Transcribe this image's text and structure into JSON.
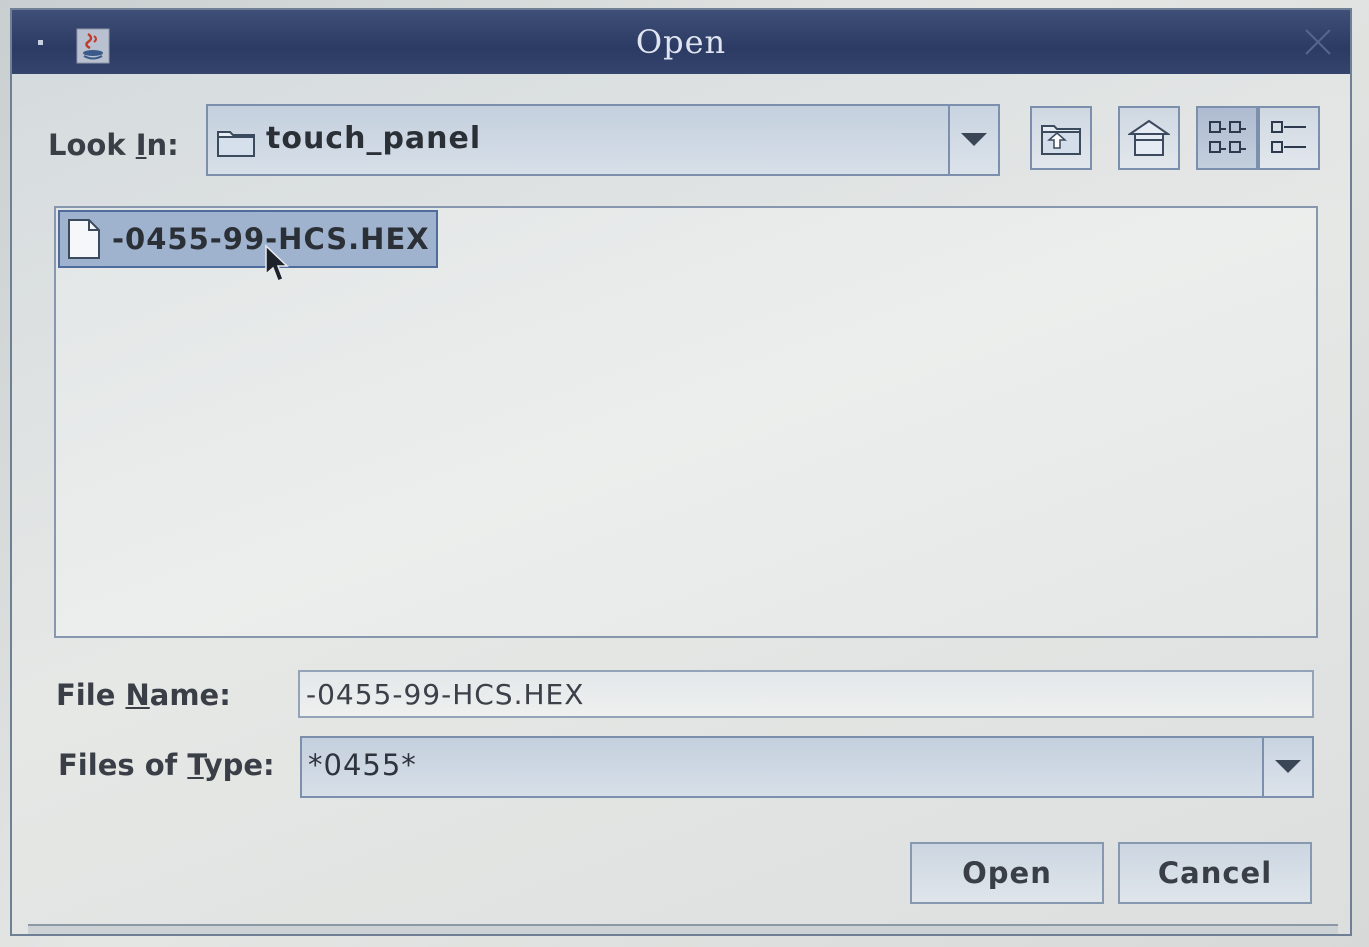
{
  "window": {
    "title": "Open"
  },
  "look_in": {
    "label_pre": "Look ",
    "label_mnemonic": "I",
    "label_post": "n:",
    "value": "touch_panel"
  },
  "toolbar": {
    "up_one_level_icon": "folder-up-icon",
    "home_icon": "home-icon",
    "list_view_icon": "list-view-icon",
    "details_view_icon": "details-view-icon"
  },
  "file_list": {
    "items": [
      {
        "name": "-0455-99-HCS.HEX",
        "selected": true
      }
    ]
  },
  "file_name": {
    "label_pre": "File ",
    "label_mnemonic": "N",
    "label_post": "ame:",
    "value": "-0455-99-HCS.HEX"
  },
  "files_of_type": {
    "label_pre": "Files of ",
    "label_mnemonic": "T",
    "label_post": "ype:",
    "value": "*0455*"
  },
  "buttons": {
    "open": "Open",
    "cancel": "Cancel"
  },
  "colors": {
    "titlebar": "#2c3b63",
    "selection": "#9fb3cf",
    "border": "#7c90ad"
  }
}
